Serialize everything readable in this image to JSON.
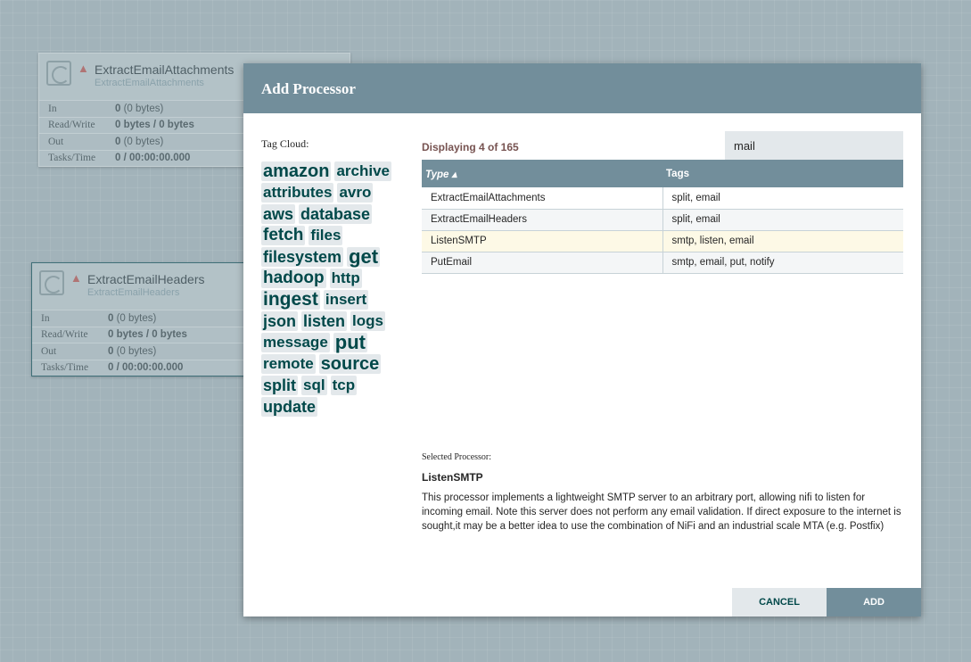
{
  "canvas": {
    "processors": [
      {
        "name": "ExtractEmailAttachments",
        "type": "ExtractEmailAttachments",
        "stats": [
          {
            "k": "In",
            "v": "0",
            "s": " (0 bytes)"
          },
          {
            "k": "Read/Write",
            "v": "0 bytes / 0 bytes",
            "s": ""
          },
          {
            "k": "Out",
            "v": "0",
            "s": " (0 bytes)"
          },
          {
            "k": "Tasks/Time",
            "v": "0 / 00:00:00.000",
            "s": ""
          }
        ]
      },
      {
        "name": "ExtractEmailHeaders",
        "type": "ExtractEmailHeaders",
        "stats": [
          {
            "k": "In",
            "v": "0",
            "s": " (0 bytes)"
          },
          {
            "k": "Read/Write",
            "v": "0 bytes / 0 bytes",
            "s": ""
          },
          {
            "k": "Out",
            "v": "0",
            "s": " (0 bytes)"
          },
          {
            "k": "Tasks/Time",
            "v": "0 / 00:00:00.000",
            "s": ""
          }
        ]
      }
    ]
  },
  "dialog": {
    "title": "Add Processor",
    "tag_cloud_label": "Tag Cloud:",
    "tags": [
      "amazon",
      "archive",
      "attributes",
      "avro",
      "aws",
      "database",
      "fetch",
      "files",
      "filesystem",
      "get",
      "hadoop",
      "http",
      "ingest",
      "insert",
      "json",
      "listen",
      "logs",
      "message",
      "put",
      "remote",
      "source",
      "split",
      "sql",
      "tcp",
      "update"
    ],
    "displaying": "Displaying 4 of 165",
    "filter_value": "mail",
    "columns": {
      "type": "Type ▴",
      "tags": "Tags"
    },
    "rows": [
      {
        "type": "ExtractEmailAttachments",
        "tags": "split, email"
      },
      {
        "type": "ExtractEmailHeaders",
        "tags": "split, email"
      },
      {
        "type": "ListenSMTP",
        "tags": "smtp, listen, email"
      },
      {
        "type": "PutEmail",
        "tags": "smtp, email, put, notify"
      }
    ],
    "selected_label": "Selected Processor:",
    "selected_name": "ListenSMTP",
    "selected_description": "This processor implements a lightweight SMTP server to an arbitrary port, allowing nifi to listen for incoming email. Note this server does not perform any email validation. If direct exposure to the internet is sought,it may be a better idea to use the combination of NiFi and an industrial scale MTA (e.g. Postfix)",
    "cancel": "CANCEL",
    "add": "ADD"
  },
  "colors": {
    "header": "#728e9b",
    "tag_text": "#004849",
    "highlight_row": "#fdf9e6"
  }
}
